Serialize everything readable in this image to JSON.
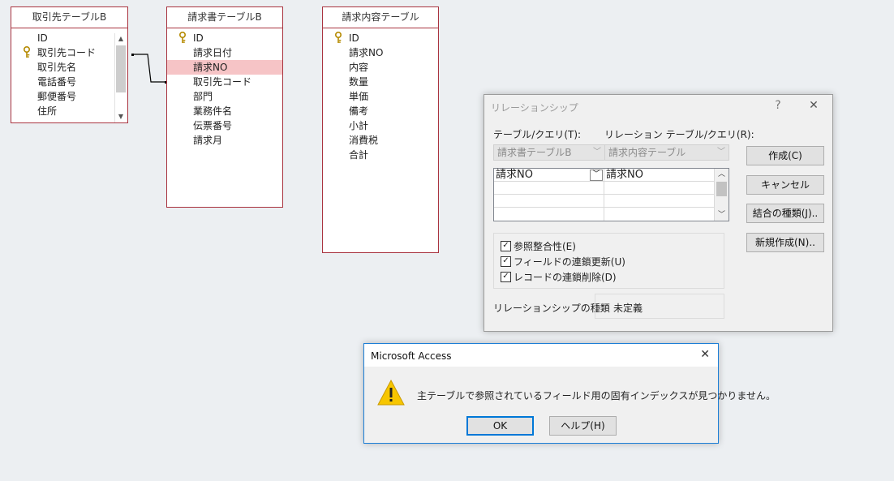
{
  "tables": [
    {
      "title": "取引先テーブルB",
      "fields": [
        "ID",
        "取引先コード",
        "取引先名",
        "電話番号",
        "郵便番号",
        "住所"
      ],
      "key_field_index": 1,
      "has_scrollbar": true
    },
    {
      "title": "請求書テーブルB",
      "fields": [
        "ID",
        "請求日付",
        "請求NO",
        "取引先コード",
        "部門",
        "業務件名",
        "伝票番号",
        "請求月"
      ],
      "key_field_index": 0,
      "highlighted_index": 2
    },
    {
      "title": "請求内容テーブル",
      "fields": [
        "ID",
        "請求NO",
        "内容",
        "数量",
        "単価",
        "備考",
        "小計",
        "消費税",
        "合計"
      ],
      "key_field_index": 0
    }
  ],
  "relation_dialog": {
    "title": "リレーションシップ",
    "help_glyph": "?",
    "close_glyph": "✕",
    "table_label": "テーブル/クエリ(T):",
    "related_label": "リレーション テーブル/クエリ(R):",
    "table_value": "請求書テーブルB",
    "related_value": "請求内容テーブル",
    "grid": {
      "left_field": "請求NO",
      "right_field": "請求NO"
    },
    "checkboxes": [
      {
        "label": "参照整合性(E)",
        "checked": true
      },
      {
        "label": "フィールドの連鎖更新(U)",
        "checked": true
      },
      {
        "label": "レコードの連鎖削除(D)",
        "checked": true
      }
    ],
    "relation_type_label": "リレーションシップの種類",
    "relation_type_value": "未定義",
    "buttons": {
      "create": "作成(C)",
      "cancel": "キャンセル",
      "join_type": "結合の種類(J)..",
      "new": "新規作成(N).."
    }
  },
  "message_box": {
    "title": "Microsoft Access",
    "close_glyph": "✕",
    "text": "主テーブルで参照されているフィールド用の固有インデックスが見つかりません。",
    "ok_label": "OK",
    "help_label": "ヘルプ(H)"
  },
  "colors": {
    "table_border": "#a9333f",
    "highlight": "#f6c4c6",
    "canvas": "#eceff2",
    "warning": "#f7c600"
  }
}
